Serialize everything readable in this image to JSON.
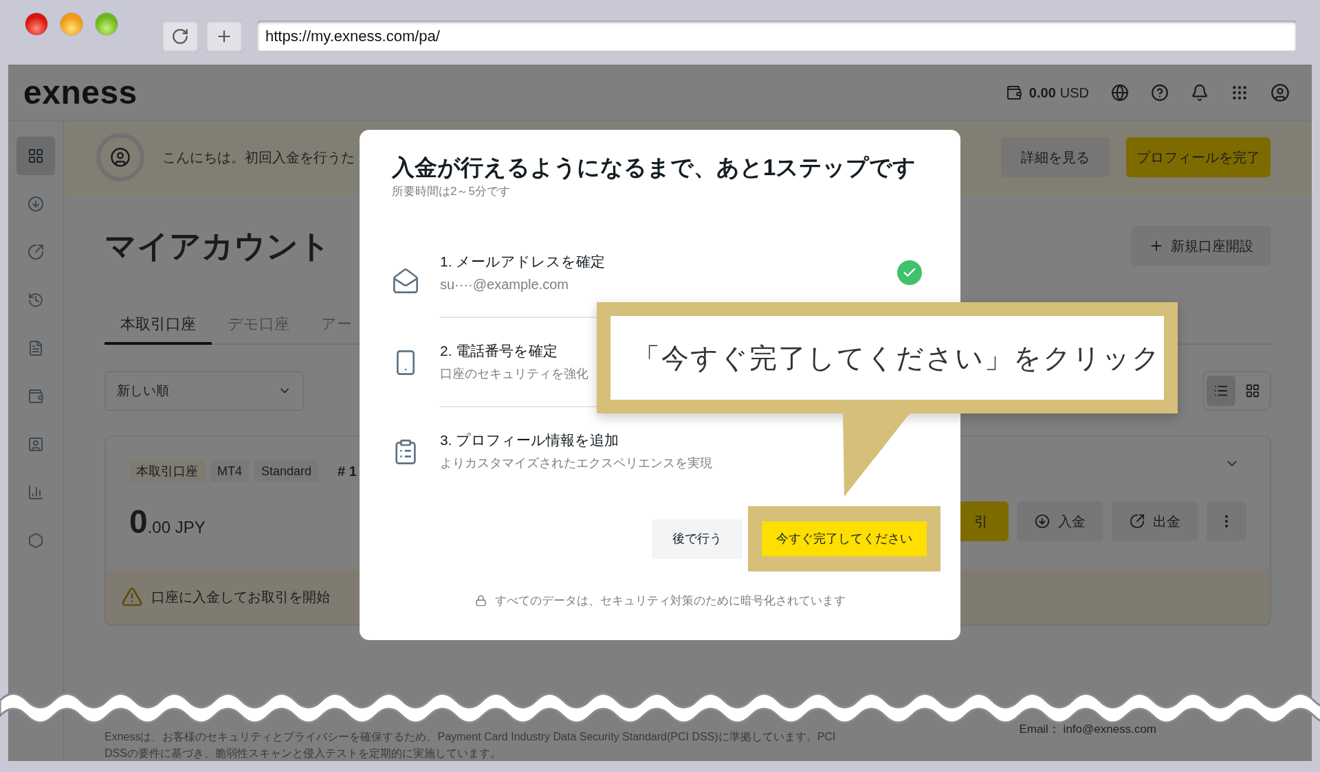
{
  "browser": {
    "url": "https://my.exness.com/pa/"
  },
  "header": {
    "logo": "exness",
    "balance": "0.00",
    "currency": "USD"
  },
  "sidebar": {
    "items": [
      {
        "selected": true
      },
      {
        "selected": false
      },
      {
        "selected": false
      },
      {
        "selected": false
      },
      {
        "selected": false
      },
      {
        "selected": false
      },
      {
        "selected": false
      },
      {
        "selected": false
      },
      {
        "selected": false
      }
    ]
  },
  "banner": {
    "greeting": "こんにちは。初回入金を行うた",
    "buttons": [
      {
        "label": "詳細を見る",
        "kind": "secondary"
      },
      {
        "label": "プロフィールを完了",
        "kind": "primary"
      }
    ]
  },
  "page": {
    "title": "マイアカウント",
    "new_account_button": "新規口座開設"
  },
  "tabs": [
    {
      "label": "本取引口座",
      "selected": true
    },
    {
      "label": "デモ口座",
      "selected": false
    },
    {
      "label": "アー",
      "selected": false
    }
  ],
  "sort": {
    "value": "新しい順"
  },
  "view_toggle": [
    {
      "kind": "list",
      "selected": true
    },
    {
      "kind": "grid",
      "selected": false
    }
  ],
  "account": {
    "tags": [
      "本取引口座",
      "MT4",
      "Standard"
    ],
    "number": "# 1",
    "balance_main": "0",
    "balance_decimal": ".00 JPY",
    "actions": [
      {
        "label": "引",
        "kind": "primary"
      },
      {
        "label": "入金",
        "kind": "deposit"
      },
      {
        "label": "出金",
        "kind": "withdraw"
      },
      {
        "kind": "more"
      }
    ],
    "notice": "口座に入金してお取引を開始"
  },
  "modal": {
    "title": "入金が行えるようになるまで、あと1ステップです",
    "subtitle": "所要時間は2～5分です",
    "steps": [
      {
        "title": "1. メールアドレスを確定",
        "detail": "su····@example.com",
        "done": true
      },
      {
        "title": "2. 電話番号を確定",
        "detail": "口座のセキュリティを強化"
      },
      {
        "title": "3. プロフィール情報を追加",
        "detail": "よりカスタマイズされたエクスペリエンスを実現",
        "done": false
      }
    ],
    "buttons": [
      {
        "label": "後で行う",
        "kind": "secondary"
      },
      {
        "label": "今すぐ完了してください",
        "kind": "primary"
      }
    ],
    "security_note": "すべてのデータは、セキュリティ対策のために暗号化されています"
  },
  "callout": {
    "text": "「今すぐ完了してください」をクリック"
  },
  "footer": {
    "notice": "Exnessは、お客様のセキュリティとプライバシーを確保するため、Payment Card Industry Data Security Standard(PCI DSS)に準拠しています。PCI DSSの要件に基づき、脆弱性スキャンと侵入テストを定期的に実施しています。",
    "email": "Email： info@exness.com"
  }
}
